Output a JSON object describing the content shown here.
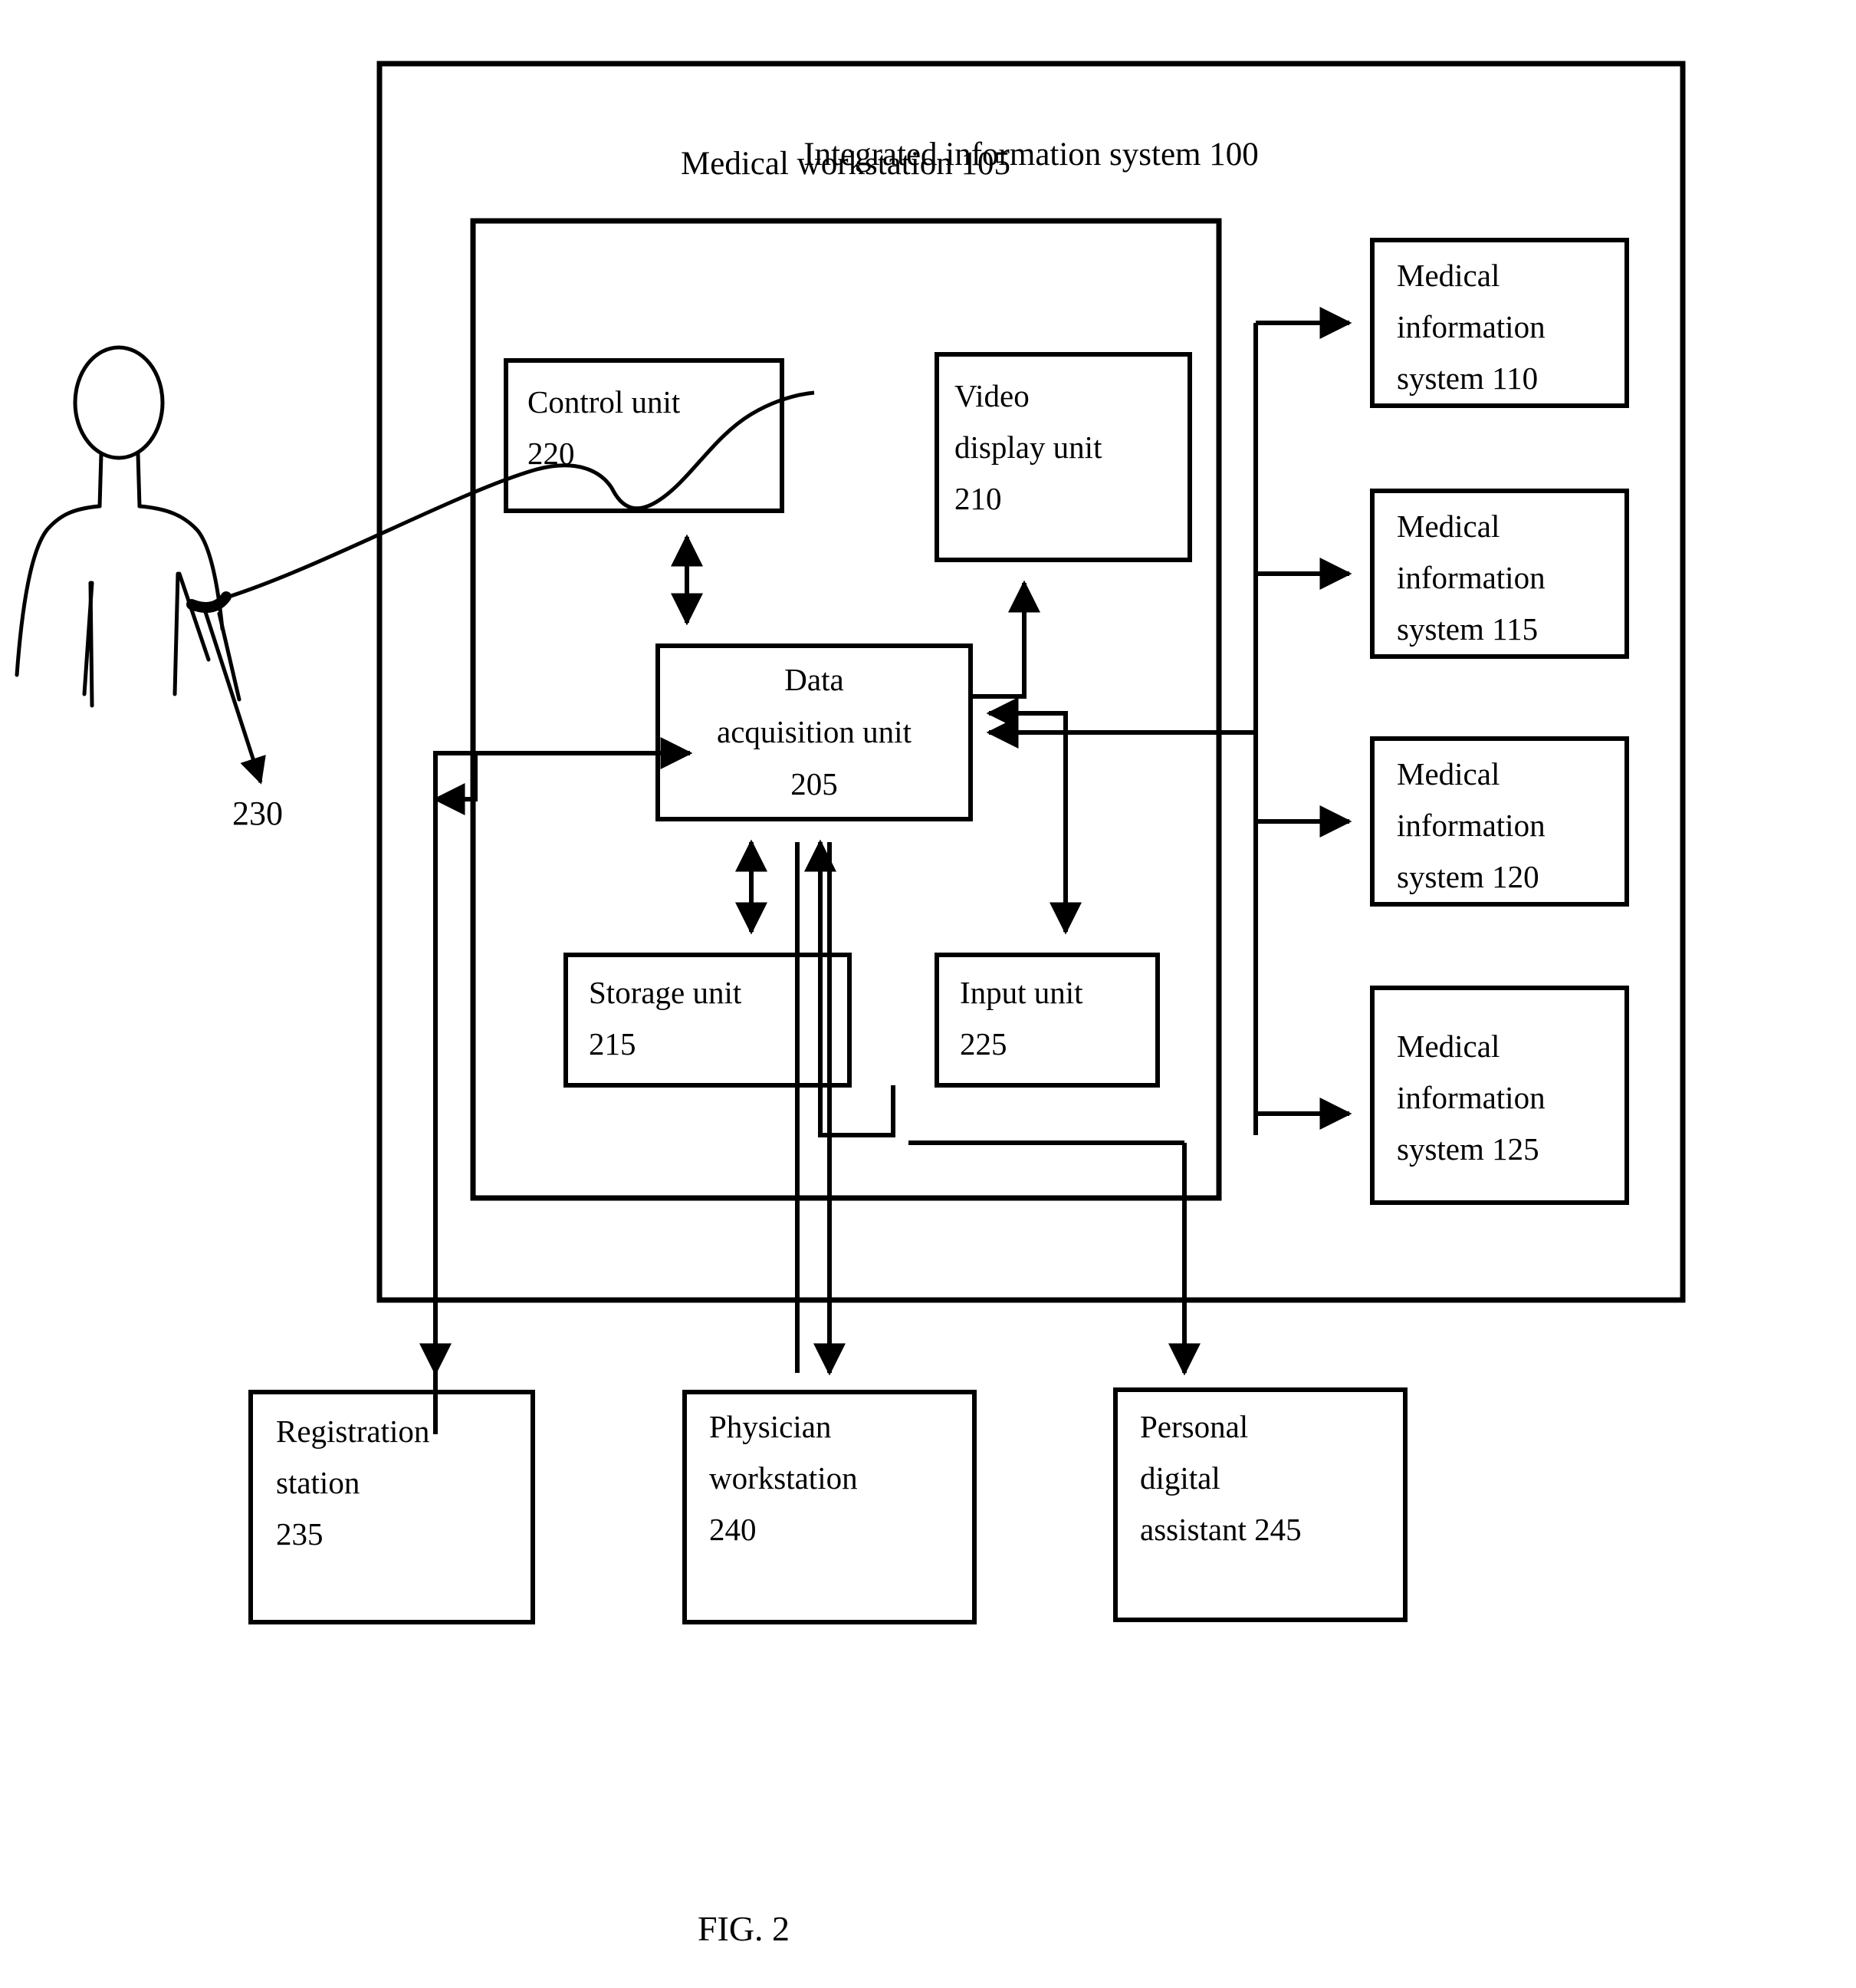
{
  "figure": {
    "caption": "FIG. 2"
  },
  "outer_system": {
    "title": "Integrated information system 100"
  },
  "workstation": {
    "title": "Medical workstation 105"
  },
  "patient": {
    "sensor_ref": "230"
  },
  "units": [
    {
      "id": "control-unit",
      "line1": "Control unit",
      "line2": "220",
      "align": "left"
    },
    {
      "id": "video-display",
      "line1": "Video",
      "line2": "display unit",
      "line3": "210",
      "align": "left"
    },
    {
      "id": "data-acq",
      "line1": "Data",
      "line2": "acquisition unit",
      "line3": "205",
      "align": "center"
    },
    {
      "id": "storage-unit",
      "line1": "Storage unit",
      "line2": "215",
      "align": "left"
    },
    {
      "id": "input-unit",
      "line1": "Input unit",
      "line2": "225",
      "align": "left"
    }
  ],
  "medical_information_systems": [
    {
      "id": "mis-110",
      "line1": "Medical",
      "line2": "information",
      "line3": "system 110"
    },
    {
      "id": "mis-115",
      "line1": "Medical",
      "line2": "information",
      "line3": "system 115"
    },
    {
      "id": "mis-120",
      "line1": "Medical",
      "line2": "information",
      "line3": "system 120"
    },
    {
      "id": "mis-125",
      "line1": "Medical",
      "line2": "information",
      "line3": "system 125"
    }
  ],
  "external_stations": [
    {
      "id": "registration-station",
      "line1": "Registration",
      "line2": "station",
      "line3": "235"
    },
    {
      "id": "physician-workstation",
      "line1": "Physician",
      "line2": "workstation",
      "line3": "240"
    },
    {
      "id": "personal-digital-assistant",
      "line1": "Personal",
      "line2": "digital",
      "line3": "assistant 245"
    }
  ],
  "colors": {
    "ink": "#000000",
    "paper": "#ffffff"
  }
}
